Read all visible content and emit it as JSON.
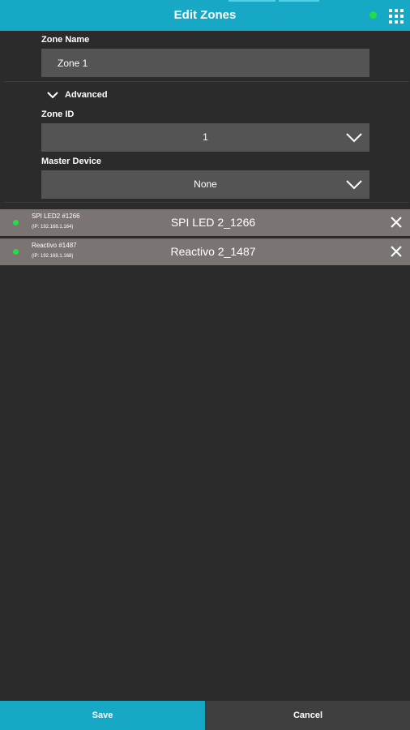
{
  "header": {
    "title": "Edit Zones",
    "status_color": "#22dd44",
    "menu_icon": "grid-menu-icon",
    "accent": "#16a8c4"
  },
  "form": {
    "zone_name_label": "Zone Name",
    "zone_name_value": "Zone 1",
    "advanced_label": "Advanced",
    "zone_id_label": "Zone ID",
    "zone_id_value": "1",
    "master_device_label": "Master Device",
    "master_device_value": "None"
  },
  "devices": [
    {
      "name": "SPI LED2 #1266",
      "ip": "(IP: 192.168.1.164)",
      "title": "SPI LED 2_1266",
      "status": "online"
    },
    {
      "name": "Reactivo #1487",
      "ip": "(IP: 192.168.1.168)",
      "title": "Reactivo 2_1487",
      "status": "online"
    }
  ],
  "footer": {
    "save_label": "Save",
    "cancel_label": "Cancel"
  }
}
